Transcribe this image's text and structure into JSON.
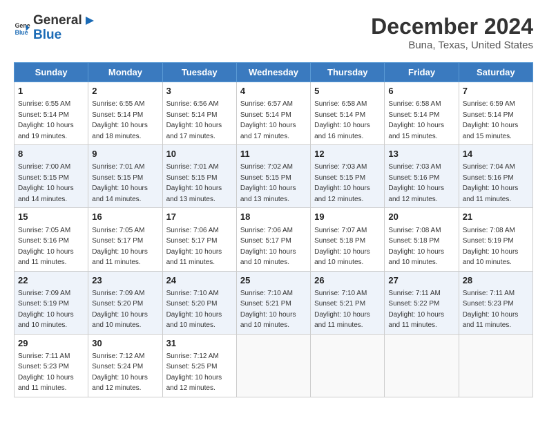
{
  "header": {
    "logo_general": "General",
    "logo_blue": "Blue",
    "title": "December 2024",
    "subtitle": "Buna, Texas, United States"
  },
  "days_of_week": [
    "Sunday",
    "Monday",
    "Tuesday",
    "Wednesday",
    "Thursday",
    "Friday",
    "Saturday"
  ],
  "weeks": [
    [
      {
        "day": "1",
        "sunrise": "6:55 AM",
        "sunset": "5:14 PM",
        "daylight": "10 hours and 19 minutes."
      },
      {
        "day": "2",
        "sunrise": "6:55 AM",
        "sunset": "5:14 PM",
        "daylight": "10 hours and 18 minutes."
      },
      {
        "day": "3",
        "sunrise": "6:56 AM",
        "sunset": "5:14 PM",
        "daylight": "10 hours and 17 minutes."
      },
      {
        "day": "4",
        "sunrise": "6:57 AM",
        "sunset": "5:14 PM",
        "daylight": "10 hours and 17 minutes."
      },
      {
        "day": "5",
        "sunrise": "6:58 AM",
        "sunset": "5:14 PM",
        "daylight": "10 hours and 16 minutes."
      },
      {
        "day": "6",
        "sunrise": "6:58 AM",
        "sunset": "5:14 PM",
        "daylight": "10 hours and 15 minutes."
      },
      {
        "day": "7",
        "sunrise": "6:59 AM",
        "sunset": "5:14 PM",
        "daylight": "10 hours and 15 minutes."
      }
    ],
    [
      {
        "day": "8",
        "sunrise": "7:00 AM",
        "sunset": "5:15 PM",
        "daylight": "10 hours and 14 minutes."
      },
      {
        "day": "9",
        "sunrise": "7:01 AM",
        "sunset": "5:15 PM",
        "daylight": "10 hours and 14 minutes."
      },
      {
        "day": "10",
        "sunrise": "7:01 AM",
        "sunset": "5:15 PM",
        "daylight": "10 hours and 13 minutes."
      },
      {
        "day": "11",
        "sunrise": "7:02 AM",
        "sunset": "5:15 PM",
        "daylight": "10 hours and 13 minutes."
      },
      {
        "day": "12",
        "sunrise": "7:03 AM",
        "sunset": "5:15 PM",
        "daylight": "10 hours and 12 minutes."
      },
      {
        "day": "13",
        "sunrise": "7:03 AM",
        "sunset": "5:16 PM",
        "daylight": "10 hours and 12 minutes."
      },
      {
        "day": "14",
        "sunrise": "7:04 AM",
        "sunset": "5:16 PM",
        "daylight": "10 hours and 11 minutes."
      }
    ],
    [
      {
        "day": "15",
        "sunrise": "7:05 AM",
        "sunset": "5:16 PM",
        "daylight": "10 hours and 11 minutes."
      },
      {
        "day": "16",
        "sunrise": "7:05 AM",
        "sunset": "5:17 PM",
        "daylight": "10 hours and 11 minutes."
      },
      {
        "day": "17",
        "sunrise": "7:06 AM",
        "sunset": "5:17 PM",
        "daylight": "10 hours and 11 minutes."
      },
      {
        "day": "18",
        "sunrise": "7:06 AM",
        "sunset": "5:17 PM",
        "daylight": "10 hours and 10 minutes."
      },
      {
        "day": "19",
        "sunrise": "7:07 AM",
        "sunset": "5:18 PM",
        "daylight": "10 hours and 10 minutes."
      },
      {
        "day": "20",
        "sunrise": "7:08 AM",
        "sunset": "5:18 PM",
        "daylight": "10 hours and 10 minutes."
      },
      {
        "day": "21",
        "sunrise": "7:08 AM",
        "sunset": "5:19 PM",
        "daylight": "10 hours and 10 minutes."
      }
    ],
    [
      {
        "day": "22",
        "sunrise": "7:09 AM",
        "sunset": "5:19 PM",
        "daylight": "10 hours and 10 minutes."
      },
      {
        "day": "23",
        "sunrise": "7:09 AM",
        "sunset": "5:20 PM",
        "daylight": "10 hours and 10 minutes."
      },
      {
        "day": "24",
        "sunrise": "7:10 AM",
        "sunset": "5:20 PM",
        "daylight": "10 hours and 10 minutes."
      },
      {
        "day": "25",
        "sunrise": "7:10 AM",
        "sunset": "5:21 PM",
        "daylight": "10 hours and 10 minutes."
      },
      {
        "day": "26",
        "sunrise": "7:10 AM",
        "sunset": "5:21 PM",
        "daylight": "10 hours and 11 minutes."
      },
      {
        "day": "27",
        "sunrise": "7:11 AM",
        "sunset": "5:22 PM",
        "daylight": "10 hours and 11 minutes."
      },
      {
        "day": "28",
        "sunrise": "7:11 AM",
        "sunset": "5:23 PM",
        "daylight": "10 hours and 11 minutes."
      }
    ],
    [
      {
        "day": "29",
        "sunrise": "7:11 AM",
        "sunset": "5:23 PM",
        "daylight": "10 hours and 11 minutes."
      },
      {
        "day": "30",
        "sunrise": "7:12 AM",
        "sunset": "5:24 PM",
        "daylight": "10 hours and 12 minutes."
      },
      {
        "day": "31",
        "sunrise": "7:12 AM",
        "sunset": "5:25 PM",
        "daylight": "10 hours and 12 minutes."
      },
      null,
      null,
      null,
      null
    ]
  ]
}
